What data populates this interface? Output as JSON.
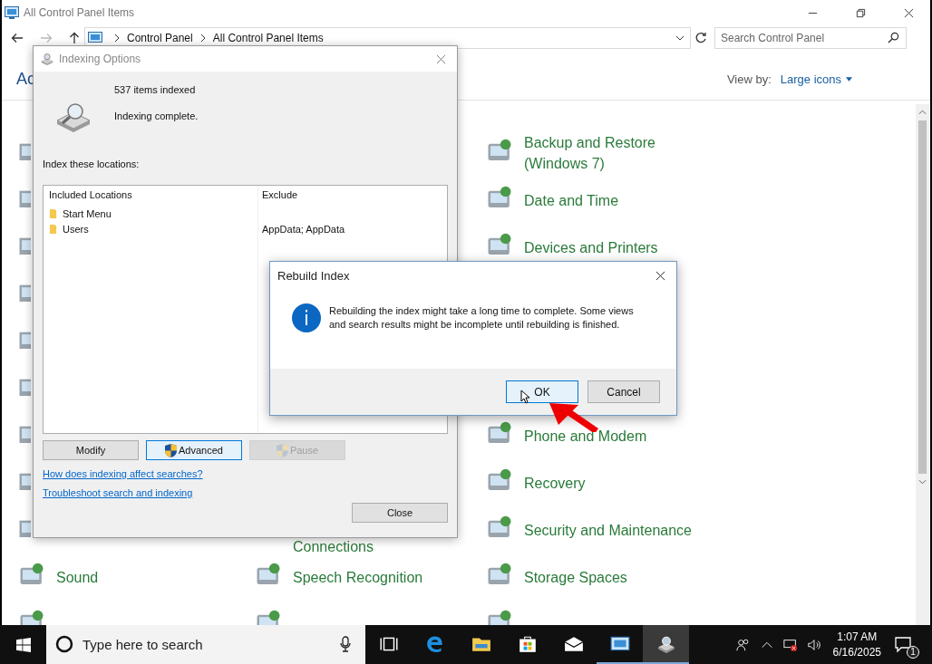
{
  "window": {
    "title": "All Control Panel Items"
  },
  "address_bar": {
    "path": [
      "Control Panel",
      "All Control Panel Items"
    ]
  },
  "search": {
    "placeholder": "Search Control Panel"
  },
  "header": {
    "title": "Ac",
    "view_by_label": "View by:",
    "view_by_value": "Large icons"
  },
  "columns": [
    [
      {
        "kind": "partial"
      },
      {
        "kind": "partial"
      },
      {
        "kind": "partial"
      },
      {
        "kind": "partial"
      },
      {
        "kind": "partial"
      },
      {
        "kind": "partial"
      },
      {
        "kind": "partial"
      },
      {
        "kind": "partial"
      },
      {
        "kind": "partial"
      },
      {
        "kind": "item",
        "label": "Sound"
      },
      {
        "kind": "icon"
      }
    ],
    [
      {
        "kind": "empty"
      },
      {
        "kind": "empty"
      },
      {
        "kind": "empty"
      },
      {
        "kind": "empty"
      },
      {
        "kind": "empty"
      },
      {
        "kind": "empty"
      },
      {
        "kind": "empty"
      },
      {
        "kind": "empty"
      },
      {
        "kind": "continued",
        "label": "Connections"
      },
      {
        "kind": "item",
        "label": "Speech Recognition"
      },
      {
        "kind": "icon"
      }
    ],
    [
      {
        "kind": "item",
        "label": "Backup and Restore (Windows 7)"
      },
      {
        "kind": "item",
        "label": "Date and Time"
      },
      {
        "kind": "item",
        "label": "Devices and Printers"
      },
      {
        "kind": "empty"
      },
      {
        "kind": "empty"
      },
      {
        "kind": "empty"
      },
      {
        "kind": "item",
        "label": "Phone and Modem"
      },
      {
        "kind": "item",
        "label": "Recovery"
      },
      {
        "kind": "item",
        "label": "Security and Maintenance"
      },
      {
        "kind": "item",
        "label": "Storage Spaces"
      },
      {
        "kind": "icon"
      }
    ]
  ],
  "indexing_dialog": {
    "title": "Indexing Options",
    "count": "537 items indexed",
    "status": "Indexing complete.",
    "locations_label": "Index these locations:",
    "columns": [
      "Included Locations",
      "Exclude"
    ],
    "rows": [
      {
        "location": "Start Menu"
      },
      {
        "location": "Users",
        "exclude": "AppData; AppData"
      }
    ],
    "buttons": [
      {
        "label": "Modify",
        "kind": "plain",
        "focused": false,
        "disabled": false
      },
      {
        "label": "Advanced",
        "kind": "shield",
        "focused": true,
        "disabled": false
      },
      {
        "label": "Pause",
        "kind": "shield",
        "focused": false,
        "disabled": true
      }
    ],
    "links": [
      "How does indexing affect searches?",
      "Troubleshoot search and indexing"
    ],
    "close_button": "Close"
  },
  "rebuild_dialog": {
    "title": "Rebuild Index",
    "message": "Rebuilding the index might take a long time to complete. Some views and search results might be incomplete until rebuilding is finished.",
    "buttons": [
      {
        "label": "OK",
        "default": true
      },
      {
        "label": "Cancel",
        "default": false
      }
    ]
  },
  "taskbar": {
    "search_placeholder": "Type here to search",
    "apps": [
      {
        "kind": "task-view",
        "running": false,
        "selected": false
      },
      {
        "kind": "edge",
        "running": false,
        "selected": false
      },
      {
        "kind": "folder",
        "running": false,
        "selected": false
      },
      {
        "kind": "store",
        "running": false,
        "selected": false
      },
      {
        "kind": "mail",
        "running": false,
        "selected": false
      },
      {
        "kind": "control-panel",
        "running": true,
        "selected": false
      },
      {
        "kind": "indexing",
        "running": true,
        "selected": true
      }
    ],
    "time": "1:07 AM",
    "date": "6/16/2025",
    "notification_count": "1"
  }
}
